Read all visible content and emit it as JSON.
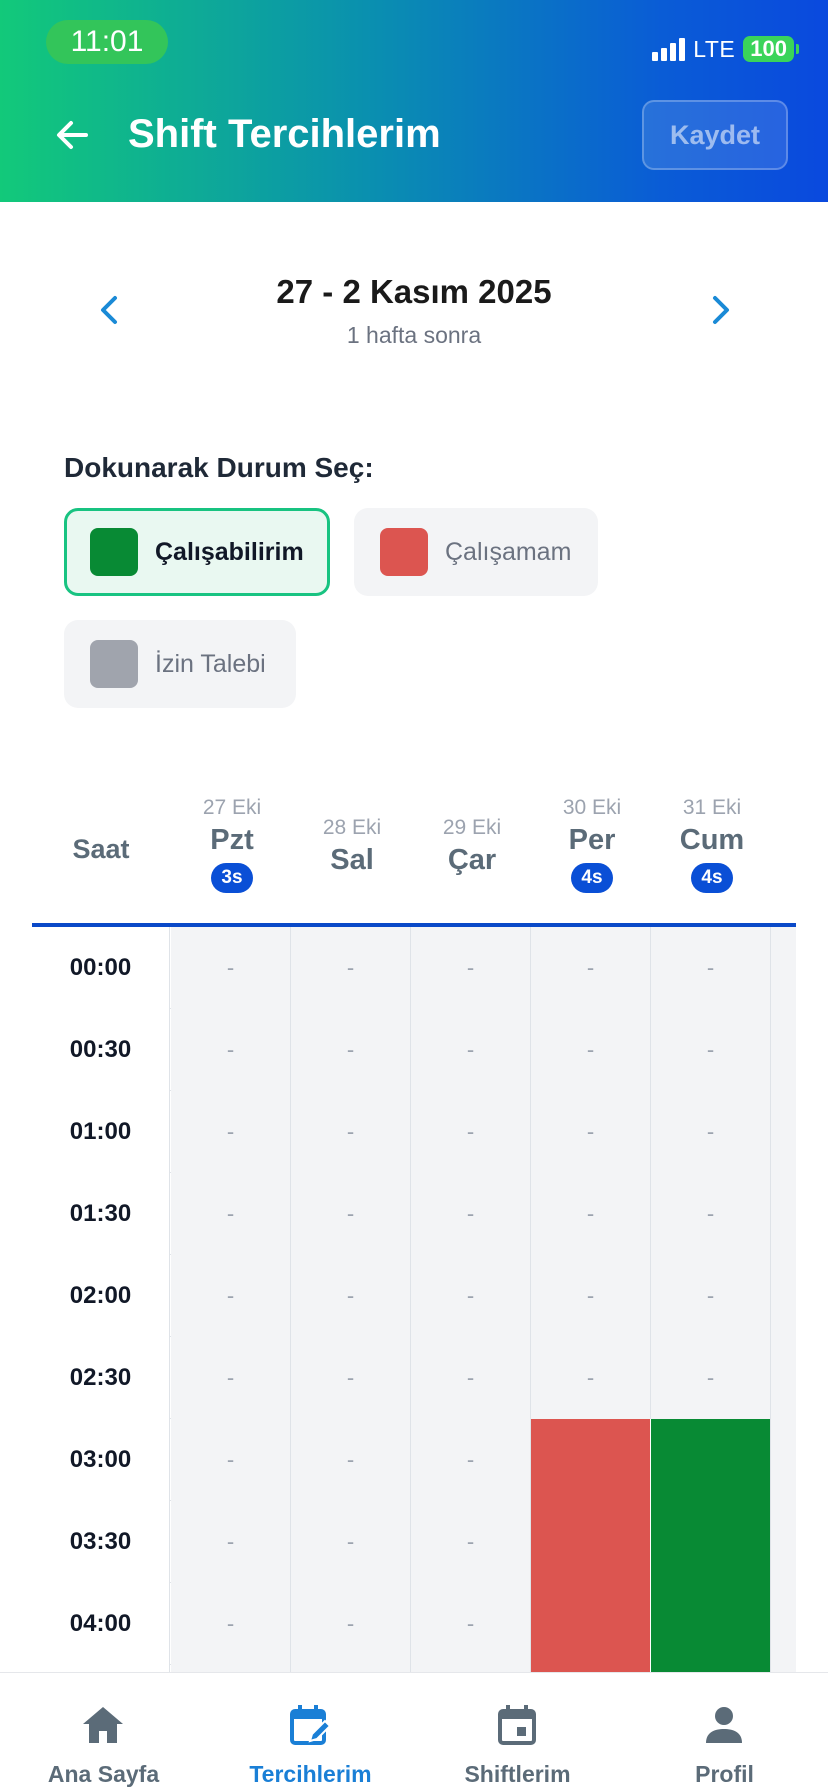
{
  "status_bar": {
    "time": "11:01",
    "network": "LTE",
    "battery": "100"
  },
  "header": {
    "title": "Shift Tercihlerim",
    "save_label": "Kaydet"
  },
  "week": {
    "title": "27 - 2 Kasım 2025",
    "subtitle": "1 hafta sonra"
  },
  "selector": {
    "label": "Dokunarak Durum Seç:",
    "options": [
      {
        "label": "Çalışabilirim",
        "color": "#088a34",
        "selected": true
      },
      {
        "label": "Çalışamam",
        "color": "#dc5550",
        "selected": false
      },
      {
        "label": "İzin Talebi",
        "color": "#a0a4ad",
        "selected": false
      }
    ]
  },
  "grid": {
    "hour_header": "Saat",
    "empty_symbol": "-",
    "days": [
      {
        "date": "27 Eki",
        "name": "Pzt",
        "badge": "3s"
      },
      {
        "date": "28 Eki",
        "name": "Sal",
        "badge": ""
      },
      {
        "date": "29 Eki",
        "name": "Çar",
        "badge": ""
      },
      {
        "date": "30 Eki",
        "name": "Per",
        "badge": "4s"
      },
      {
        "date": "31 Eki",
        "name": "Cum",
        "badge": "4s"
      }
    ],
    "rows": [
      {
        "time": "00:00",
        "cells": [
          "-",
          "-",
          "-",
          "-",
          "-"
        ]
      },
      {
        "time": "00:30",
        "cells": [
          "-",
          "-",
          "-",
          "-",
          "-"
        ]
      },
      {
        "time": "01:00",
        "cells": [
          "-",
          "-",
          "-",
          "-",
          "-"
        ]
      },
      {
        "time": "01:30",
        "cells": [
          "-",
          "-",
          "-",
          "-",
          "-"
        ]
      },
      {
        "time": "02:00",
        "cells": [
          "-",
          "-",
          "-",
          "-",
          "-"
        ]
      },
      {
        "time": "02:30",
        "cells": [
          "-",
          "-",
          "-",
          "-",
          "-"
        ]
      },
      {
        "time": "03:00",
        "cells": [
          "-",
          "-",
          "-",
          "red",
          "green"
        ]
      },
      {
        "time": "03:30",
        "cells": [
          "-",
          "-",
          "-",
          "red",
          "green"
        ]
      },
      {
        "time": "04:00",
        "cells": [
          "-",
          "-",
          "-",
          "red",
          "green"
        ]
      },
      {
        "time": "",
        "cells": [
          "-",
          "-",
          "-",
          "red",
          "green"
        ]
      }
    ]
  },
  "bottom_nav": {
    "items": [
      {
        "label": "Ana Sayfa",
        "icon": "home-icon"
      },
      {
        "label": "Tercihlerim",
        "icon": "calendar-edit-icon",
        "active": true
      },
      {
        "label": "Shiftlerim",
        "icon": "calendar-icon"
      },
      {
        "label": "Profil",
        "icon": "person-icon"
      }
    ]
  }
}
